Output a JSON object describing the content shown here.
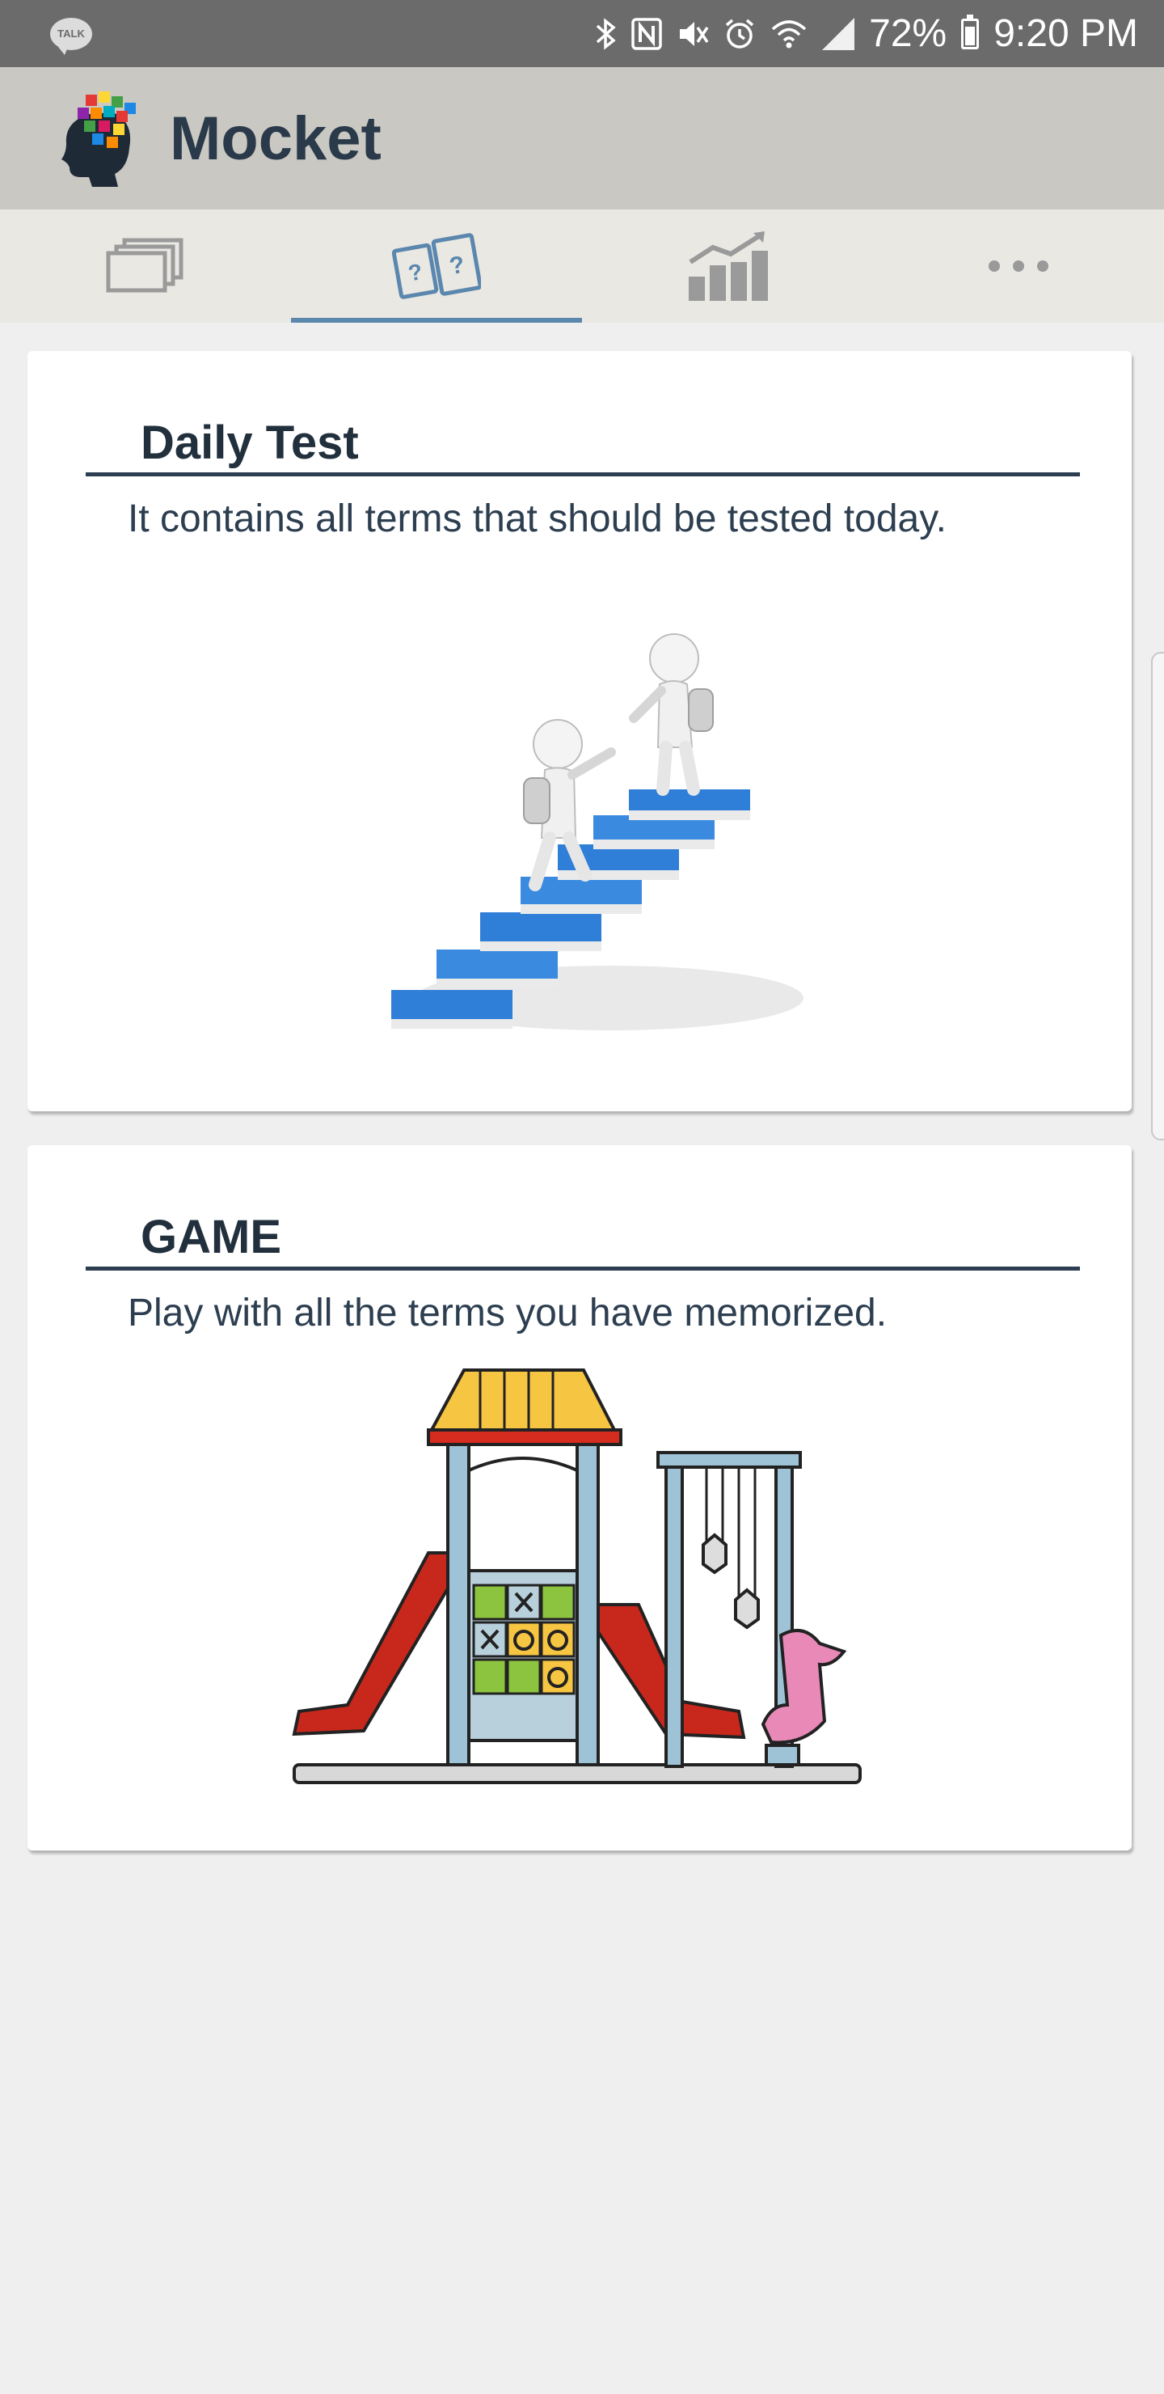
{
  "status_bar": {
    "left_icon": "talk-icon",
    "left_icon_label": "TALK",
    "battery": "72%",
    "time": "9:20 PM",
    "icons": [
      "bluetooth-icon",
      "nfc-icon",
      "mute-icon",
      "alarm-icon",
      "wifi-icon",
      "signal-icon",
      "battery-icon"
    ]
  },
  "app": {
    "title": "Mocket",
    "logo_icon": "brain-puzzle-logo"
  },
  "tabs": [
    {
      "icon": "cards-stack-icon",
      "active": false
    },
    {
      "icon": "quiz-cards-icon",
      "active": true
    },
    {
      "icon": "bar-chart-icon",
      "active": false
    },
    {
      "icon": "more-icon",
      "active": false
    }
  ],
  "cards": {
    "daily": {
      "heading": "Daily Test",
      "description": "It contains all terms that should be tested today.",
      "illustration": "figures-climbing-book-stairs"
    },
    "game": {
      "heading": "GAME",
      "description": "Play with all the terms you have memorized.",
      "illustration": "playground-tic-tac-toe"
    }
  },
  "colors": {
    "status_bar": "#6b6b6b",
    "app_bar": "#c9c8c2",
    "tab_bar": "#e9e8e3",
    "tab_indicator": "#5b87ae",
    "heading_text": "#22303e",
    "background": "#efefef"
  }
}
